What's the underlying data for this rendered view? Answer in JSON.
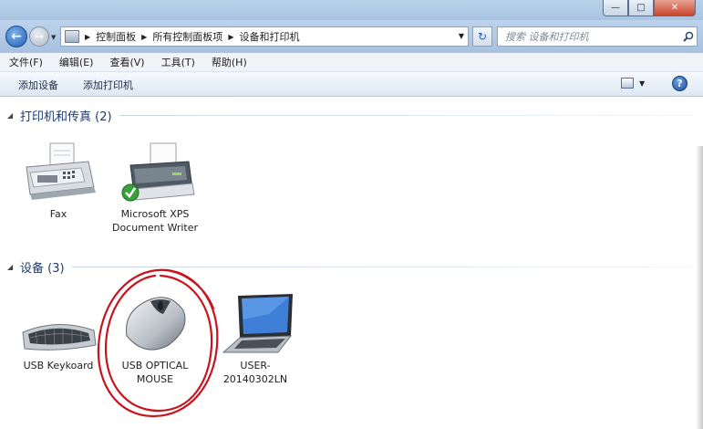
{
  "window": {
    "controls": [
      "minimize",
      "maximize",
      "close"
    ],
    "close_glyph": "✕",
    "minimize_glyph": "—",
    "maximize_glyph": "□"
  },
  "nav": {
    "back_icon": "back-arrow-icon",
    "forward_icon": "forward-arrow-icon",
    "breadcrumbs": [
      "控制面板",
      "所有控制面板项",
      "设备和打印机"
    ],
    "search_placeholder": "搜索 设备和打印机"
  },
  "menu": {
    "items": [
      "文件(F)",
      "编辑(E)",
      "查看(V)",
      "工具(T)",
      "帮助(H)"
    ]
  },
  "toolbar": {
    "add_device": "添加设备",
    "add_printer": "添加打印机"
  },
  "groups": {
    "printers": {
      "label": "打印机和传真 (2)",
      "items": [
        {
          "label": "Fax",
          "icon": "fax-icon"
        },
        {
          "label": "Microsoft XPS Document Writer",
          "icon": "printer-icon",
          "default": true
        }
      ]
    },
    "devices": {
      "label": "设备 (3)",
      "items": [
        {
          "label": "USB Keykoard",
          "icon": "keyboard-icon"
        },
        {
          "label": "USB OPTICAL MOUSE",
          "icon": "mouse-icon"
        },
        {
          "label": "USER-20140302LN",
          "icon": "laptop-icon"
        }
      ]
    }
  },
  "annotation_color": "#c8141e"
}
